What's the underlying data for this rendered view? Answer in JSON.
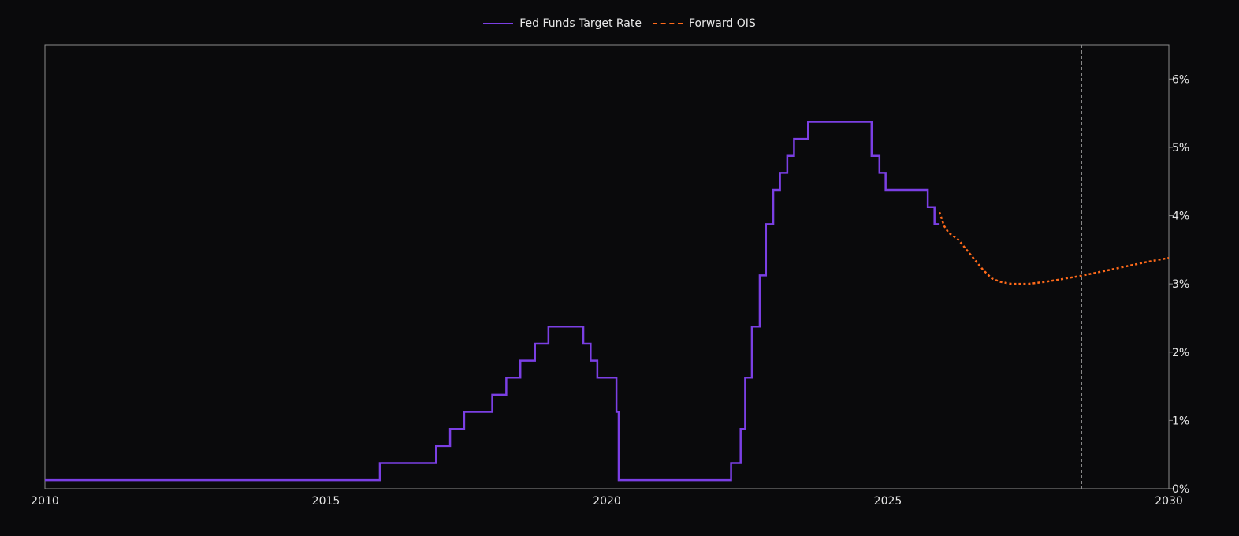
{
  "chart_data": {
    "type": "line",
    "title": "",
    "xlabel": "",
    "ylabel": "",
    "xlim": [
      2010,
      2030
    ],
    "ylim": [
      0,
      6.5
    ],
    "x_ticks": [
      "2010",
      "2015",
      "2020",
      "2025",
      "2030"
    ],
    "y_ticks": [
      "0%",
      "1%",
      "2%",
      "3%",
      "4%",
      "5%",
      "6%"
    ],
    "y_axis_side": "right",
    "legend_position": "top-center",
    "vline_x": 2028.45,
    "colors": {
      "background": "#0a0a0c",
      "fed": "#7b3fe4",
      "ois": "#ff6a1a",
      "axis": "#9a9a9a"
    },
    "series": [
      {
        "name": "Fed Funds Target Rate",
        "style": "step",
        "color": "#7b3fe4",
        "points": [
          [
            2010.0,
            0.125
          ],
          [
            2015.96,
            0.375
          ],
          [
            2016.96,
            0.625
          ],
          [
            2017.21,
            0.875
          ],
          [
            2017.46,
            1.125
          ],
          [
            2017.96,
            1.375
          ],
          [
            2018.21,
            1.625
          ],
          [
            2018.46,
            1.875
          ],
          [
            2018.72,
            2.125
          ],
          [
            2018.96,
            2.375
          ],
          [
            2019.58,
            2.125
          ],
          [
            2019.71,
            1.875
          ],
          [
            2019.83,
            1.625
          ],
          [
            2020.17,
            1.125
          ],
          [
            2020.21,
            0.125
          ],
          [
            2022.21,
            0.375
          ],
          [
            2022.38,
            0.875
          ],
          [
            2022.46,
            1.625
          ],
          [
            2022.58,
            2.375
          ],
          [
            2022.72,
            3.125
          ],
          [
            2022.83,
            3.875
          ],
          [
            2022.96,
            4.375
          ],
          [
            2023.08,
            4.625
          ],
          [
            2023.21,
            4.875
          ],
          [
            2023.33,
            5.125
          ],
          [
            2023.58,
            5.375
          ],
          [
            2024.71,
            4.875
          ],
          [
            2024.85,
            4.625
          ],
          [
            2024.96,
            4.375
          ],
          [
            2025.71,
            4.125
          ],
          [
            2025.83,
            3.875
          ],
          [
            2025.92,
            3.875
          ]
        ]
      },
      {
        "name": "Forward OIS",
        "style": "dotted",
        "color": "#ff6a1a",
        "points": [
          [
            2025.92,
            4.05
          ],
          [
            2026.0,
            3.85
          ],
          [
            2026.08,
            3.75
          ],
          [
            2026.25,
            3.65
          ],
          [
            2026.4,
            3.5
          ],
          [
            2026.55,
            3.35
          ],
          [
            2026.7,
            3.2
          ],
          [
            2026.85,
            3.08
          ],
          [
            2027.0,
            3.03
          ],
          [
            2027.2,
            3.0
          ],
          [
            2027.5,
            3.0
          ],
          [
            2027.8,
            3.03
          ],
          [
            2028.1,
            3.07
          ],
          [
            2028.45,
            3.12
          ],
          [
            2028.8,
            3.18
          ],
          [
            2029.2,
            3.25
          ],
          [
            2029.6,
            3.32
          ],
          [
            2030.0,
            3.38
          ]
        ]
      }
    ]
  }
}
